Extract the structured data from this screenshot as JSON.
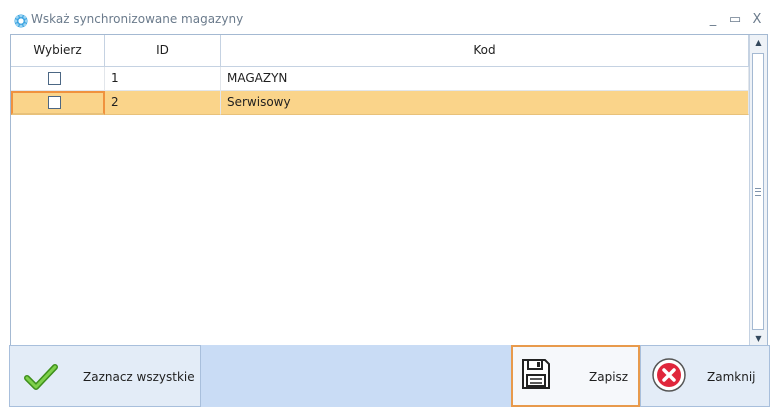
{
  "window": {
    "title": "Wskaż synchronizowane magazyny",
    "minimize_glyph": "_",
    "maximize_glyph": "▭",
    "close_glyph": "X"
  },
  "grid": {
    "columns": [
      "Wybierz",
      "ID",
      "Kod"
    ],
    "rows": [
      {
        "checked": false,
        "id": "1",
        "kod": "MAGAZYN",
        "selected": false
      },
      {
        "checked": false,
        "id": "2",
        "kod": "Serwisowy",
        "selected": true
      }
    ],
    "scroll_up_glyph": "▲",
    "scroll_down_glyph": "▼"
  },
  "toolbar": {
    "select_all_label": "Zaznacz wszystkie",
    "save_label": "Zapisz",
    "close_label": "Zamknij"
  },
  "icons": {
    "app": "gear-icon",
    "select_all": "checkmark-icon",
    "save": "floppy-disk-icon",
    "close": "close-circle-icon"
  },
  "colors": {
    "selected_row": "#fad48a",
    "focus_border": "#f0923e",
    "toolbar_bg": "#c9dcf5",
    "checkmark_green": "#5cb82a",
    "close_red": "#e0263b"
  }
}
